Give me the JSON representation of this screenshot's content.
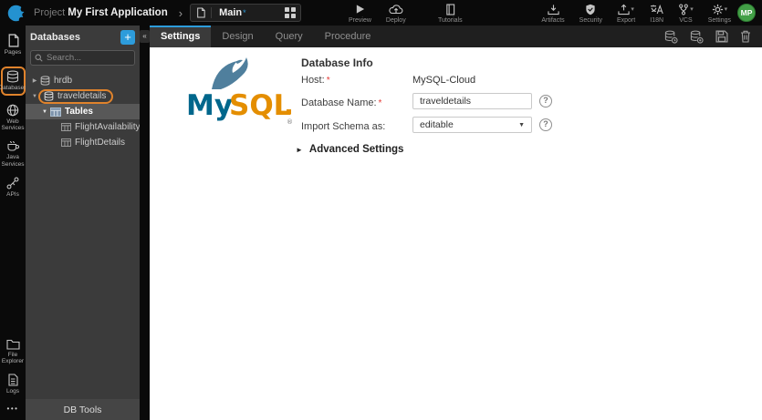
{
  "icons": {
    "breadcrumb_chevron": "›",
    "add": "+",
    "collapse": "«",
    "caret_down": "▾",
    "tree_expanded": "▼",
    "tree_collapsed": "▶",
    "section_collapsed": "►",
    "more": "•••"
  },
  "required_marker": "*",
  "topbar": {
    "project_label": "Project",
    "project_name": "My First Application",
    "page_name": "Main",
    "dirty_marker": "*",
    "actions": [
      {
        "label": "Preview"
      },
      {
        "label": "Deploy"
      },
      {
        "label": "Tutorials"
      }
    ],
    "tools": [
      {
        "label": "Artifacts"
      },
      {
        "label": "Security"
      },
      {
        "label": "Export"
      },
      {
        "label": "I18N"
      },
      {
        "label": "VCS"
      },
      {
        "label": "Settings"
      }
    ],
    "avatar_initials": "MP"
  },
  "sidebar": {
    "items": [
      {
        "label": "Pages"
      },
      {
        "label": "Databases",
        "active": true
      },
      {
        "label": "Web Services"
      },
      {
        "label": "Java Services"
      },
      {
        "label": "APIs"
      }
    ],
    "bottom_items": [
      {
        "label": "File Explorer"
      },
      {
        "label": "Logs"
      }
    ]
  },
  "db_panel": {
    "title": "Databases",
    "search_placeholder": "Search...",
    "tree": [
      {
        "label": "hrdb"
      },
      {
        "label": "traveldetails"
      },
      {
        "label": "Tables"
      },
      {
        "label": "FlightAvailability"
      },
      {
        "label": "FlightDetails"
      }
    ],
    "footer": "DB Tools"
  },
  "main": {
    "tabs": [
      {
        "label": "Settings",
        "active": true
      },
      {
        "label": "Design"
      },
      {
        "label": "Query"
      },
      {
        "label": "Procedure"
      }
    ],
    "logo": {
      "my": "My",
      "sql": "SQL",
      "reg": "®"
    },
    "form": {
      "heading": "Database Info",
      "host_label": "Host:",
      "host_value": "MySQL-Cloud",
      "dbname_label": "Database Name:",
      "dbname_value": "traveldetails",
      "schema_label": "Import Schema as:",
      "schema_value": "editable",
      "help_glyph": "?",
      "advanced_label": "Advanced Settings"
    }
  },
  "colors": {
    "accent": "#2d9cdb",
    "annotation": "#e0832c",
    "avatar_green": "#43a047",
    "mysql_blue": "#00678c",
    "mysql_orange": "#e48e00"
  }
}
